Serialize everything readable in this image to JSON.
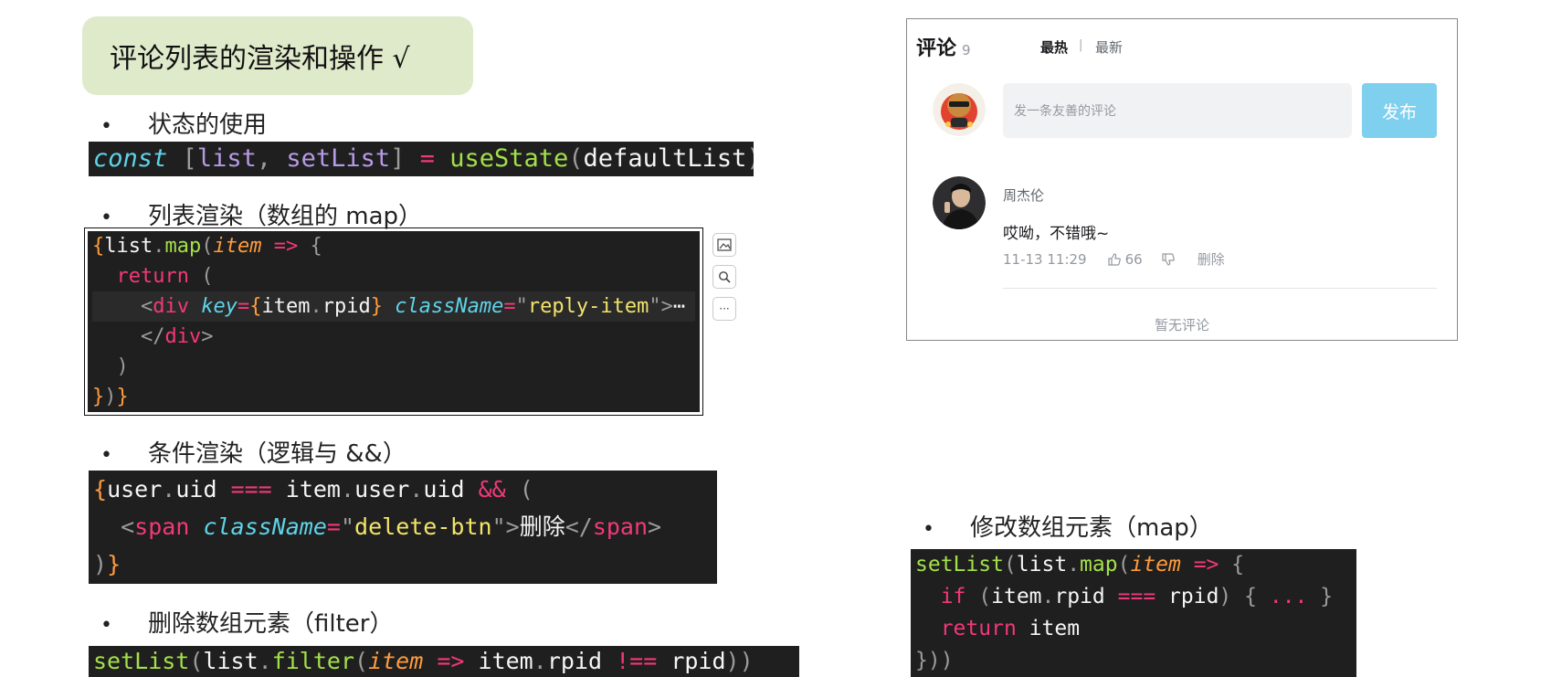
{
  "title": "评论列表的渲染和操作 √",
  "bullet_symbol": "•",
  "sections": {
    "state": {
      "label": "状态的使用"
    },
    "list_render": {
      "label": "列表渲染（数组的 map）"
    },
    "conditional": {
      "label": "条件渲染（逻辑与 &&）"
    },
    "delete": {
      "label": "删除数组元素（filter）"
    },
    "modify": {
      "label": "修改数组元素（map）"
    }
  },
  "code": {
    "state": "const [list, setList] = useState(defaultList)",
    "list_render": [
      "{list.map(item => {",
      "  return (",
      "    <div key={item.rpid} className=\"reply-item\">⋯",
      "    </div>",
      "  )",
      "})}"
    ],
    "conditional": [
      "{user.uid === item.user.uid && (",
      "  <span className=\"delete-btn\">删除</span>",
      ")}"
    ],
    "delete": "setList(list.filter(item => item.rpid !== rpid))",
    "modify": [
      "setList(list.map(item => {",
      "  if (item.rpid === rpid) { ... }",
      "  return item",
      "}))"
    ]
  },
  "side_buttons": [
    {
      "icon": "image-edit-icon"
    },
    {
      "icon": "search-icon"
    },
    {
      "icon": "more-icon",
      "label": "···"
    }
  ],
  "comment_panel": {
    "header": "评论",
    "count": "9",
    "tab_hot": "最热",
    "tab_separator": "|",
    "tab_new": "最新",
    "input_placeholder": "发一条友善的评论",
    "publish_label": "发布",
    "comment": {
      "username": "周杰伦",
      "text": "哎呦，不错哦~",
      "time": "11-13 11:29",
      "likes": "66",
      "delete_label": "删除"
    },
    "empty_text": "暂无评论"
  }
}
